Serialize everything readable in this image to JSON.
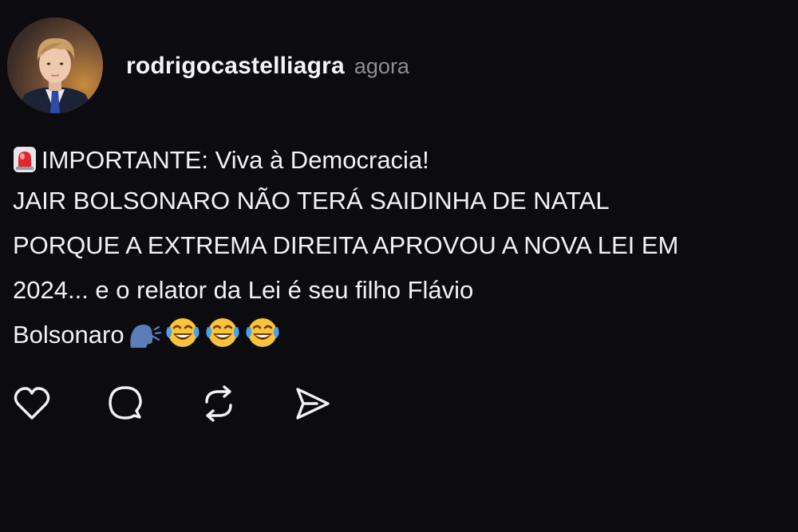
{
  "post": {
    "author": {
      "username": "rodrigocastelliagra",
      "avatar_icon": "profile-photo"
    },
    "timestamp": "agora",
    "text": {
      "line1_icon": "rotating-light-siren-icon",
      "line1": "IMPORTANTE: Viva à Democracia!",
      "line2": "JAIR BOLSONARO NÃO TERÁ SAIDINHA DE NATAL",
      "line3": "PORQUE A EXTREMA DIREITA APROVOU A NOVA LEI EM",
      "line4": "2024... e o relator da Lei é seu filho Flávio",
      "line5": "Bolsonaro",
      "line5_emojis": [
        "speaking-head-icon",
        "tears-of-joy-icon",
        "tears-of-joy-icon",
        "tears-of-joy-icon"
      ]
    },
    "actions": [
      {
        "name": "like",
        "icon": "heart-icon"
      },
      {
        "name": "comment",
        "icon": "speech-bubble-icon"
      },
      {
        "name": "repost",
        "icon": "repost-icon"
      },
      {
        "name": "share",
        "icon": "send-icon"
      }
    ]
  },
  "colors": {
    "background": "#0c0b10",
    "text": "#f2f2f2",
    "muted": "#8e8e93"
  }
}
